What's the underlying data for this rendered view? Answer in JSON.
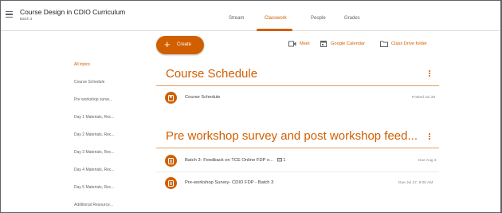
{
  "header": {
    "course_title": "Course Design in CDIO Curriculum",
    "course_subtitle": "Batch 3",
    "tabs": [
      "Stream",
      "Classwork",
      "People",
      "Grades"
    ],
    "active_tab": "Classwork"
  },
  "toolbar": {
    "create_label": "Create",
    "meet_label": "Meet",
    "calendar_label": "Google Calendar",
    "drive_label": "Class Drive folder"
  },
  "topics": [
    "All topics",
    "Course Schedule",
    "Pre workshop surve...",
    "Day 1 Materials, Rec...",
    "Day 2 Materials, Rec...",
    "Day 3 Materials, Rec...",
    "Day 4 Materials, Rec...",
    "Day 5 Materials, Rec...",
    "Additional Resource..."
  ],
  "sections": [
    {
      "title": "Course Schedule",
      "items": [
        {
          "title": "Course Schedule",
          "meta": "Posted Jul 28"
        }
      ]
    },
    {
      "title": "Pre workshop survey and post workshop feed...",
      "items": [
        {
          "title": "Batch 3- Feedback on TCE Online FDP o...",
          "comments": "1",
          "meta": "Due Aug 3"
        },
        {
          "title": "Pre-workshop Survey- CDIO FDP - Batch 3",
          "meta": "Due Jul 27, 9:00 AM"
        }
      ]
    }
  ],
  "colors": {
    "accent": "#d15f00",
    "text": "#3c4043",
    "muted": "#5f6368",
    "divider": "#dadce0"
  }
}
